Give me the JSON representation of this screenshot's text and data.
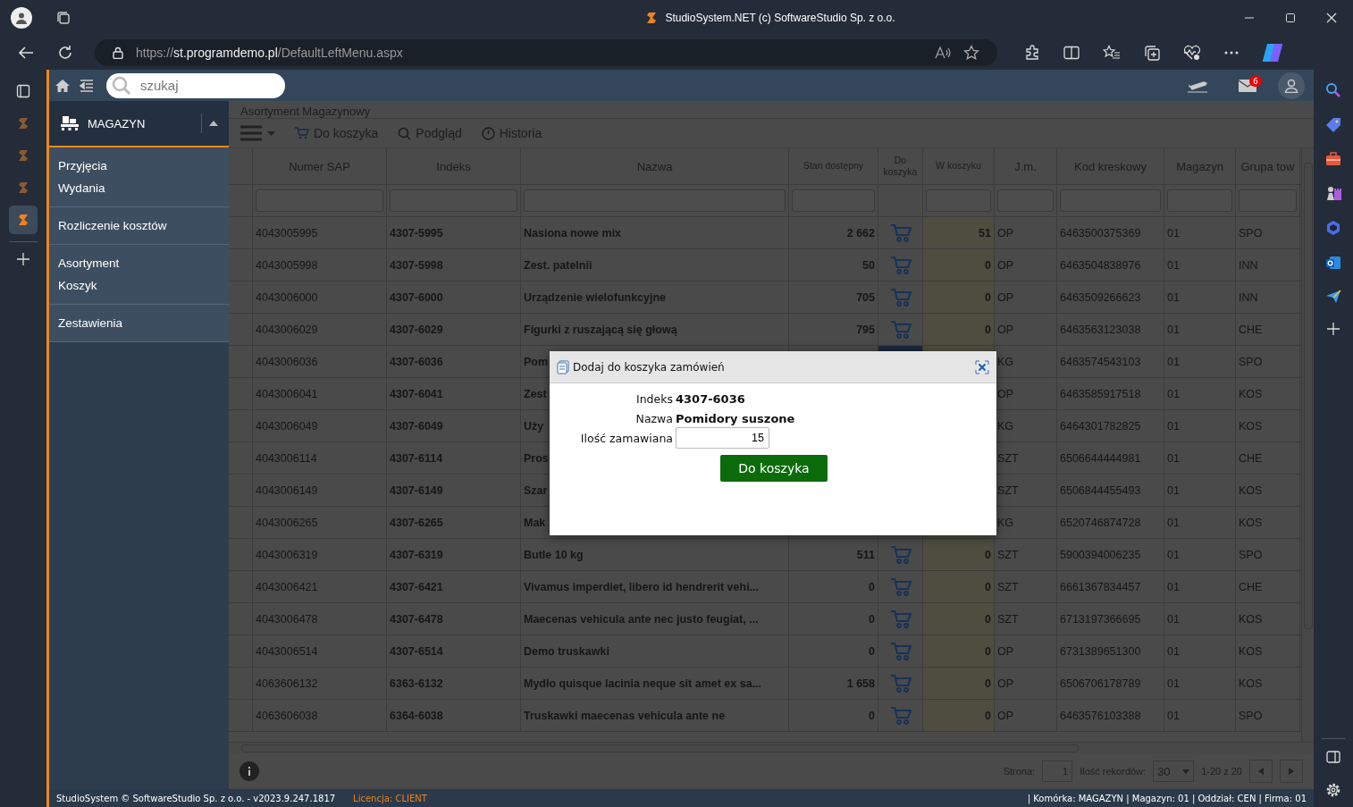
{
  "browser": {
    "tabs": [
      {
        "selected": false
      },
      {
        "selected": false
      },
      {
        "selected": false
      },
      {
        "selected": true
      }
    ],
    "title": "StudioSystem.NET (c) SoftwareStudio Sp. z o.o.",
    "url_scheme": "https://",
    "url_host": "st.programdemo.pl",
    "url_path": "/DefaultLeftMenu.aspx"
  },
  "app_bar": {
    "search_placeholder": "szukaj",
    "mail_badge": "6"
  },
  "module": {
    "title": "MAGAZYN",
    "expanded": true
  },
  "menu_groups": [
    {
      "items": [
        "Przyjęcia",
        "Wydania"
      ]
    },
    {
      "items": [
        "Rozliczenie kosztów"
      ]
    },
    {
      "items": [
        "Asortyment",
        "Koszyk"
      ]
    },
    {
      "items": [
        "Zestawienia"
      ]
    }
  ],
  "page": {
    "title": "Asortyment Magazynowy",
    "toolbar": [
      {
        "kind": "cart",
        "label": "Do koszyka"
      },
      {
        "kind": "search",
        "label": "Podgląd"
      },
      {
        "kind": "clock",
        "label": "Historia"
      }
    ]
  },
  "table": {
    "columns": [
      "Numer SAP",
      "Indeks",
      "Nazwa",
      "Stan dostępny",
      "Do koszyka",
      "W koszyku",
      "J.m.",
      "Kod kreskowy",
      "Magazyn",
      "Grupa tow"
    ],
    "rows": [
      {
        "sap": "4043005995",
        "indeks": "4307-5995",
        "nazwa": "Nasiona nowe mix",
        "stan": "2 662",
        "w_koszyku": "51",
        "jm": "OP",
        "kod": "6463500375369",
        "magazyn": "01",
        "grupa": "SPO",
        "selected": false
      },
      {
        "sap": "4043005998",
        "indeks": "4307-5998",
        "nazwa": "Zest. patelnii",
        "stan": "50",
        "w_koszyku": "0",
        "jm": "OP",
        "kod": "6463504838976",
        "magazyn": "01",
        "grupa": "INN",
        "selected": false
      },
      {
        "sap": "4043006000",
        "indeks": "4307-6000",
        "nazwa": "Urządzenie wielofunkcyjne",
        "stan": "705",
        "w_koszyku": "0",
        "jm": "OP",
        "kod": "6463509266623",
        "magazyn": "01",
        "grupa": "INN",
        "selected": false
      },
      {
        "sap": "4043006029",
        "indeks": "4307-6029",
        "nazwa": "Figurki z ruszającą się głową",
        "stan": "795",
        "w_koszyku": "0",
        "jm": "OP",
        "kod": "6463563123038",
        "magazyn": "01",
        "grupa": "CHE",
        "selected": false
      },
      {
        "sap": "4043006036",
        "indeks": "4307-6036",
        "nazwa": "Pom",
        "jm": "KG",
        "kod": "6463574543103",
        "magazyn": "01",
        "grupa": "SPO",
        "selected": true
      },
      {
        "sap": "4043006041",
        "indeks": "4307-6041",
        "nazwa": "Zest",
        "jm": "OP",
        "kod": "6463585917518",
        "magazyn": "01",
        "grupa": "KOS"
      },
      {
        "sap": "4043006049",
        "indeks": "4307-6049",
        "nazwa": "Uży",
        "jm": "KG",
        "kod": "6464301782825",
        "magazyn": "01",
        "grupa": "KOS"
      },
      {
        "sap": "4043006114",
        "indeks": "4307-6114",
        "nazwa": "Pros",
        "jm": "SZT",
        "kod": "6506644444981",
        "magazyn": "01",
        "grupa": "CHE"
      },
      {
        "sap": "4043006149",
        "indeks": "4307-6149",
        "nazwa": "Szar",
        "jm": "SZT",
        "kod": "6506844455493",
        "magazyn": "01",
        "grupa": "KOS"
      },
      {
        "sap": "4043006265",
        "indeks": "4307-6265",
        "nazwa": "Mak",
        "jm": "KG",
        "kod": "6520746874728",
        "magazyn": "01",
        "grupa": "KOS"
      },
      {
        "sap": "4043006319",
        "indeks": "4307-6319",
        "nazwa": "Butle 10 kg",
        "stan": "511",
        "w_koszyku": "0",
        "jm": "SZT",
        "kod": "5900394006235",
        "magazyn": "01",
        "grupa": "SPO",
        "selected": false
      },
      {
        "sap": "4043006421",
        "indeks": "4307-6421",
        "nazwa": "Vivamus imperdiet, libero id hendrerit vehi...",
        "stan": "0",
        "w_koszyku": "0",
        "jm": "SZT",
        "kod": "6661367834457",
        "magazyn": "01",
        "grupa": "CHE",
        "selected": false
      },
      {
        "sap": "4043006478",
        "indeks": "4307-6478",
        "nazwa": "Maecenas vehicula ante nec justo feugiat, ...",
        "stan": "0",
        "w_koszyku": "0",
        "jm": "SZT",
        "kod": "6713197366695",
        "magazyn": "01",
        "grupa": "KOS",
        "selected": false
      },
      {
        "sap": "4043006514",
        "indeks": "4307-6514",
        "nazwa": "Demo truskawki",
        "stan": "0",
        "w_koszyku": "0",
        "jm": "OP",
        "kod": "6731389651300",
        "magazyn": "01",
        "grupa": "KOS",
        "selected": false
      },
      {
        "sap": "4063606132",
        "indeks": "6363-6132",
        "nazwa": "Mydło quisque lacinia neque sit amet ex sa...",
        "stan": "1 658",
        "w_koszyku": "0",
        "jm": "OP",
        "kod": "6506706178789",
        "magazyn": "01",
        "grupa": "KOS",
        "selected": false
      },
      {
        "sap": "4063606038",
        "indeks": "6364-6038",
        "nazwa": "Truskawki maecenas vehicula ante ne",
        "stan": "0",
        "w_koszyku": "0",
        "jm": "OP",
        "kod": "6463576103388",
        "magazyn": "01",
        "grupa": "SPO",
        "selected": false
      }
    ]
  },
  "pager": {
    "page_label": "Strona:",
    "page": "1",
    "records_label": "Ilość rekordów:",
    "records": "30",
    "range": "1-20 z 20"
  },
  "dialog": {
    "title": "Dodaj do koszyka zamówień",
    "fields": [
      {
        "label": "Indeks",
        "value": "4307-6036"
      },
      {
        "label": "Nazwa",
        "value": "Pomidory suszone"
      }
    ],
    "qty_label": "Ilość zamawiana",
    "qty": "15",
    "button": "Do koszyka"
  },
  "footer": {
    "copyright": "StudioSystem © SoftwareStudio Sp. z o.o. - v2023.9.247.1817",
    "license": "Licencja: CLIENT",
    "info": "| Komórka: MAGAZYN | Magazyn: 01 | Oddział: CEN | Firma: 01"
  }
}
